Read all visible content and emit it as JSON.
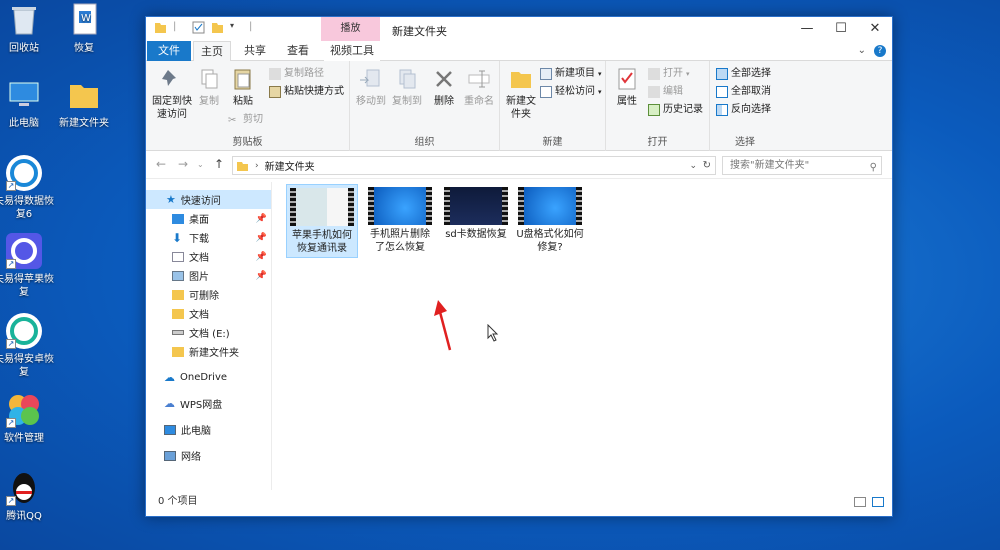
{
  "desktop": {
    "icons": [
      {
        "label": "回收站",
        "icon": "recycle-bin-icon"
      },
      {
        "label": "恢复",
        "icon": "document-icon"
      },
      {
        "label": "此电脑",
        "icon": "computer-icon"
      },
      {
        "label": "新建文件夹",
        "icon": "folder-icon"
      },
      {
        "label": "失易得数据恢复6",
        "icon": "app-icon"
      },
      {
        "label": "失易得苹果恢复",
        "icon": "app-icon"
      },
      {
        "label": "失易得安卓恢复",
        "icon": "app-icon"
      },
      {
        "label": "软件管理",
        "icon": "app-icon"
      },
      {
        "label": "腾讯QQ",
        "icon": "qq-icon"
      }
    ]
  },
  "window": {
    "title": "新建文件夹",
    "context_tab": "播放",
    "tabs": {
      "file": "文件",
      "home": "主页",
      "share": "共享",
      "view": "查看",
      "video_tools": "视频工具"
    },
    "buttons": {
      "minimize": "—",
      "maximize": "☐",
      "close": "✕"
    }
  },
  "ribbon": {
    "clipboard": {
      "label": "剪贴板",
      "pin": "固定到快速访问",
      "copy": "复制",
      "paste": "粘贴",
      "copy_path": "复制路径",
      "paste_shortcut": "粘贴快捷方式",
      "cut": "剪切"
    },
    "organize": {
      "label": "组织",
      "move_to": "移动到",
      "copy_to": "复制到",
      "delete": "删除",
      "rename": "重命名"
    },
    "new": {
      "label": "新建",
      "new_folder": "新建文件夹",
      "new_item": "新建项目",
      "easy_access": "轻松访问"
    },
    "open": {
      "label": "打开",
      "properties": "属性",
      "open": "打开",
      "edit": "编辑",
      "history": "历史记录"
    },
    "select": {
      "label": "选择",
      "select_all": "全部选择",
      "select_none": "全部取消",
      "invert": "反向选择"
    }
  },
  "address": {
    "path": "新建文件夹",
    "search_placeholder": "搜索\"新建文件夹\""
  },
  "nav": {
    "quick_access": "快速访问",
    "items": [
      {
        "label": "桌面",
        "pinned": true
      },
      {
        "label": "下载",
        "pinned": true
      },
      {
        "label": "文档",
        "pinned": true
      },
      {
        "label": "图片",
        "pinned": true
      },
      {
        "label": "可删除",
        "pinned": false
      },
      {
        "label": "文档",
        "pinned": false
      },
      {
        "label": "文档 (E:)",
        "pinned": false
      },
      {
        "label": "新建文件夹",
        "pinned": false
      }
    ],
    "onedrive": "OneDrive",
    "wps": "WPS网盘",
    "this_pc": "此电脑",
    "network": "网络"
  },
  "files": [
    {
      "name": "苹果手机如何恢复通讯录",
      "selected": true
    },
    {
      "name": "手机照片删除了怎么恢复",
      "selected": false
    },
    {
      "name": "sd卡数据恢复",
      "selected": false
    },
    {
      "name": "U盘格式化如何修复?",
      "selected": false
    }
  ],
  "status": {
    "count": "0 个项目"
  },
  "colors": {
    "accent": "#1979ca",
    "selection": "#cce8ff",
    "context_tab": "#f8c8dc",
    "annotation_arrow": "#e02020"
  }
}
